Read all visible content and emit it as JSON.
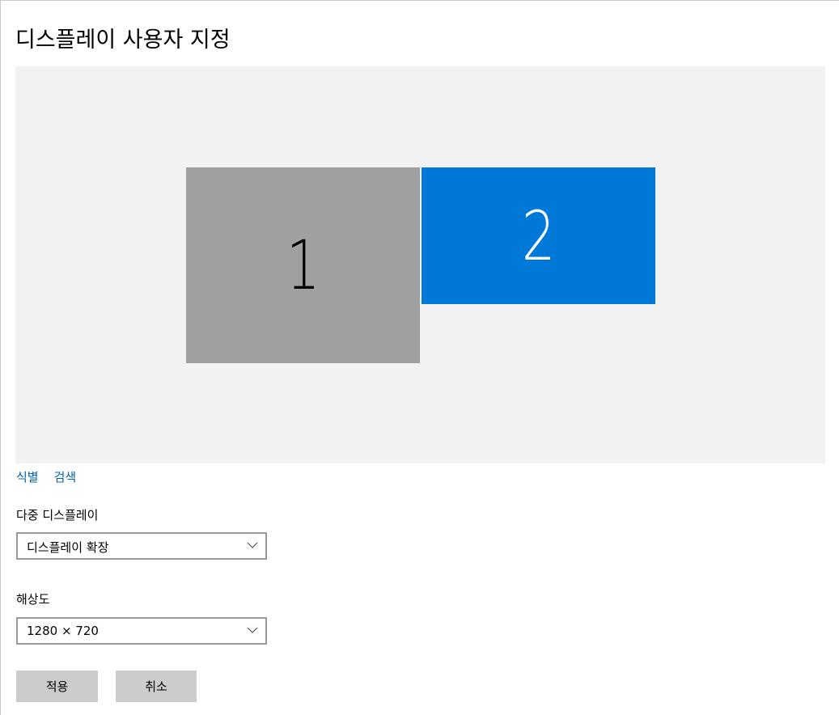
{
  "page": {
    "title": "디스플레이 사용자 지정"
  },
  "arrange": {
    "monitors": [
      {
        "number": "1",
        "selected": false
      },
      {
        "number": "2",
        "selected": true
      }
    ]
  },
  "links": {
    "identify": "식별",
    "detect": "검색"
  },
  "multiple_displays": {
    "label": "다중 디스플레이",
    "value": "디스플레이 확장"
  },
  "resolution": {
    "label": "해상도",
    "value": "1280 × 720"
  },
  "buttons": {
    "apply": "적용",
    "cancel": "취소"
  },
  "colors": {
    "selected_monitor": "#0078d7",
    "unselected_monitor": "#a0a0a0",
    "link": "#0063b1",
    "arrange_background": "#f2f2f2",
    "button_background": "#cccccc"
  }
}
